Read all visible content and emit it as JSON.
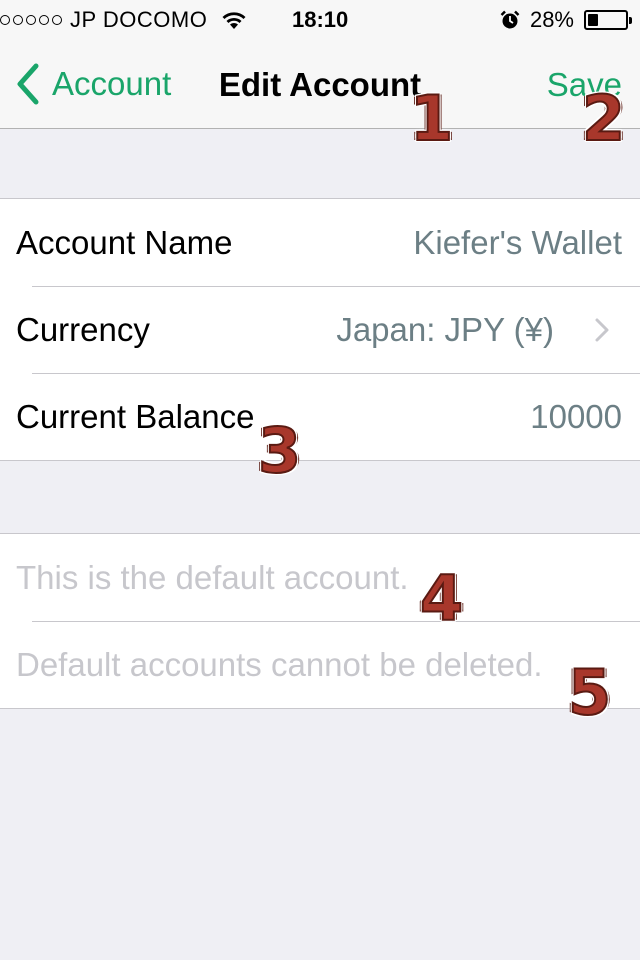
{
  "status_bar": {
    "carrier": "JP DOCOMO",
    "time": "18:10",
    "battery_percent": "28%",
    "battery_level": 0.28,
    "icons": [
      "signal-dots-icon",
      "wifi-icon",
      "alarm-icon",
      "battery-icon"
    ]
  },
  "nav": {
    "back_label": "Account",
    "title": "Edit Account",
    "save_label": "Save",
    "accent_color": "#1aa56a"
  },
  "account_group": {
    "rows": [
      {
        "label": "Account Name",
        "value": "Kiefer's Wallet"
      },
      {
        "label": "Currency",
        "value": "Japan: JPY (¥)"
      },
      {
        "label": "Current Balance",
        "value": "10000"
      }
    ]
  },
  "notes_group": {
    "rows": [
      "This is the default account.",
      "Default accounts cannot be deleted."
    ]
  },
  "annotations": [
    "1",
    "2",
    "3",
    "4",
    "5"
  ]
}
